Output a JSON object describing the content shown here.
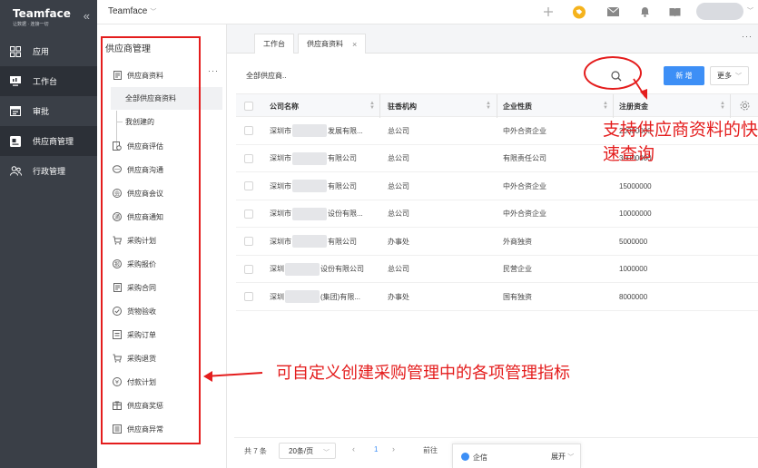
{
  "brand": {
    "name": "Teamface",
    "slogan": "让数据 · 连接一切"
  },
  "leftnav": {
    "items": [
      {
        "label": "应用",
        "icon": "grid-icon"
      },
      {
        "label": "工作台",
        "icon": "workbench-icon"
      },
      {
        "label": "审批",
        "icon": "approval-icon"
      },
      {
        "label": "供应商管理",
        "icon": "supplier-icon"
      },
      {
        "label": "行政管理",
        "icon": "people-icon"
      }
    ]
  },
  "topbar": {
    "app_name": "Teamface"
  },
  "subnav": {
    "title": "供应商管理",
    "more": "···",
    "items": [
      {
        "label": "供应商资料"
      },
      {
        "label": "全部供应商资料"
      },
      {
        "label": "我创建的"
      },
      {
        "label": "供应商评估"
      },
      {
        "label": "供应商沟通"
      },
      {
        "label": "供应商会议"
      },
      {
        "label": "供应商通知"
      },
      {
        "label": "采购计划"
      },
      {
        "label": "采购报价"
      },
      {
        "label": "采购合同"
      },
      {
        "label": "货物验收"
      },
      {
        "label": "采购订单"
      },
      {
        "label": "采购退货"
      },
      {
        "label": "付款计划"
      },
      {
        "label": "供应商奖惩"
      },
      {
        "label": "供应商异常"
      }
    ]
  },
  "tabs": {
    "workbench": "工作台",
    "supplier": "供应商资料",
    "more": "···"
  },
  "toolbar": {
    "filter_label": "全部供应商..",
    "new_label": "新 增",
    "more_label": "更多"
  },
  "table": {
    "headers": {
      "company": "公司名称",
      "org": "驻香机构",
      "nature": "企业性质",
      "capital": "注册资金"
    },
    "rows": [
      {
        "c1": "深圳市",
        "c2": "发展有限...",
        "org": "总公司",
        "nature": "中外合资企业",
        "capital": "20000000"
      },
      {
        "c1": "深圳市",
        "c2": "有限公司",
        "org": "总公司",
        "nature": "有限责任公司",
        "capital": "30000000"
      },
      {
        "c1": "深圳市",
        "c2": "有限公司",
        "org": "总公司",
        "nature": "中外合资企业",
        "capital": "15000000"
      },
      {
        "c1": "深圳市",
        "c2": "设份有限...",
        "org": "总公司",
        "nature": "中外合资企业",
        "capital": "10000000"
      },
      {
        "c1": "深圳市",
        "c2": "有限公司",
        "org": "办事处",
        "nature": "外商独资",
        "capital": "5000000"
      },
      {
        "c1": "深圳",
        "c2": "设份有限公司",
        "org": "总公司",
        "nature": "民营企业",
        "capital": "1000000"
      },
      {
        "c1": "深圳",
        "c2": "(集团)有限...",
        "org": "办事处",
        "nature": "国有独资",
        "capital": "8000000"
      }
    ]
  },
  "pager": {
    "total": "共 7 条",
    "page_size": "20条/页",
    "page": "1",
    "goto": "前往"
  },
  "chat": {
    "label": "企信",
    "toggle": "展开"
  },
  "annotations": {
    "search_tip": "支持供应商资料的快速查询",
    "custom_tip": "可自定义创建采购管理中的各项管理指标"
  },
  "colors": {
    "accent": "#3d8ff6",
    "nav_bg": "#3a3f47",
    "annotation": "#e41d1d"
  }
}
